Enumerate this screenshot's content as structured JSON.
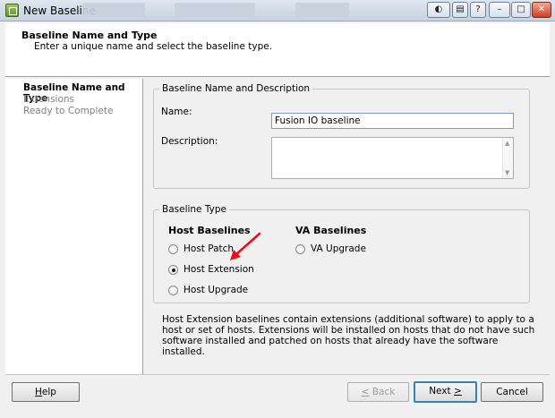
{
  "window": {
    "title": "New Baseline",
    "accent": "#c8432a"
  },
  "header": {
    "title": "Baseline Name and Type",
    "subtitle": "Enter a unique name and select the baseline type."
  },
  "steps": [
    {
      "label": "Baseline Name and Type",
      "active": true
    },
    {
      "label": "Extensions",
      "active": false
    },
    {
      "label": "Ready to Complete",
      "active": false
    }
  ],
  "name_desc_group": {
    "legend": "Baseline Name and Description",
    "name_label": "Name:",
    "name_value": "Fusion IO baseline",
    "description_label": "Description:",
    "description_value": ""
  },
  "type_group": {
    "legend": "Baseline Type",
    "host_heading": "Host Baselines",
    "va_heading": "VA Baselines",
    "host_options": [
      {
        "label": "Host Patch",
        "checked": false
      },
      {
        "label": "Host Extension",
        "checked": true
      },
      {
        "label": "Host Upgrade",
        "checked": false
      }
    ],
    "va_options": [
      {
        "label": "VA Upgrade",
        "checked": false
      }
    ]
  },
  "info_text": "Host Extension baselines contain extensions (additional software) to apply to a host or set of hosts. Extensions will be installed on hosts that do not have such software installed and patched on hosts that already have the software installed.",
  "buttons": {
    "help_mnemonic": "H",
    "help_rest": "elp",
    "back_mnemonic": "<",
    "back_rest": " Back",
    "next_text": "Next ",
    "next_mnemonic": ">",
    "cancel": "Cancel"
  },
  "icons": {
    "app": "vsphere-client-icon",
    "arrow": "red-annotation-arrow-icon",
    "arrow_color": "#e8111a"
  }
}
